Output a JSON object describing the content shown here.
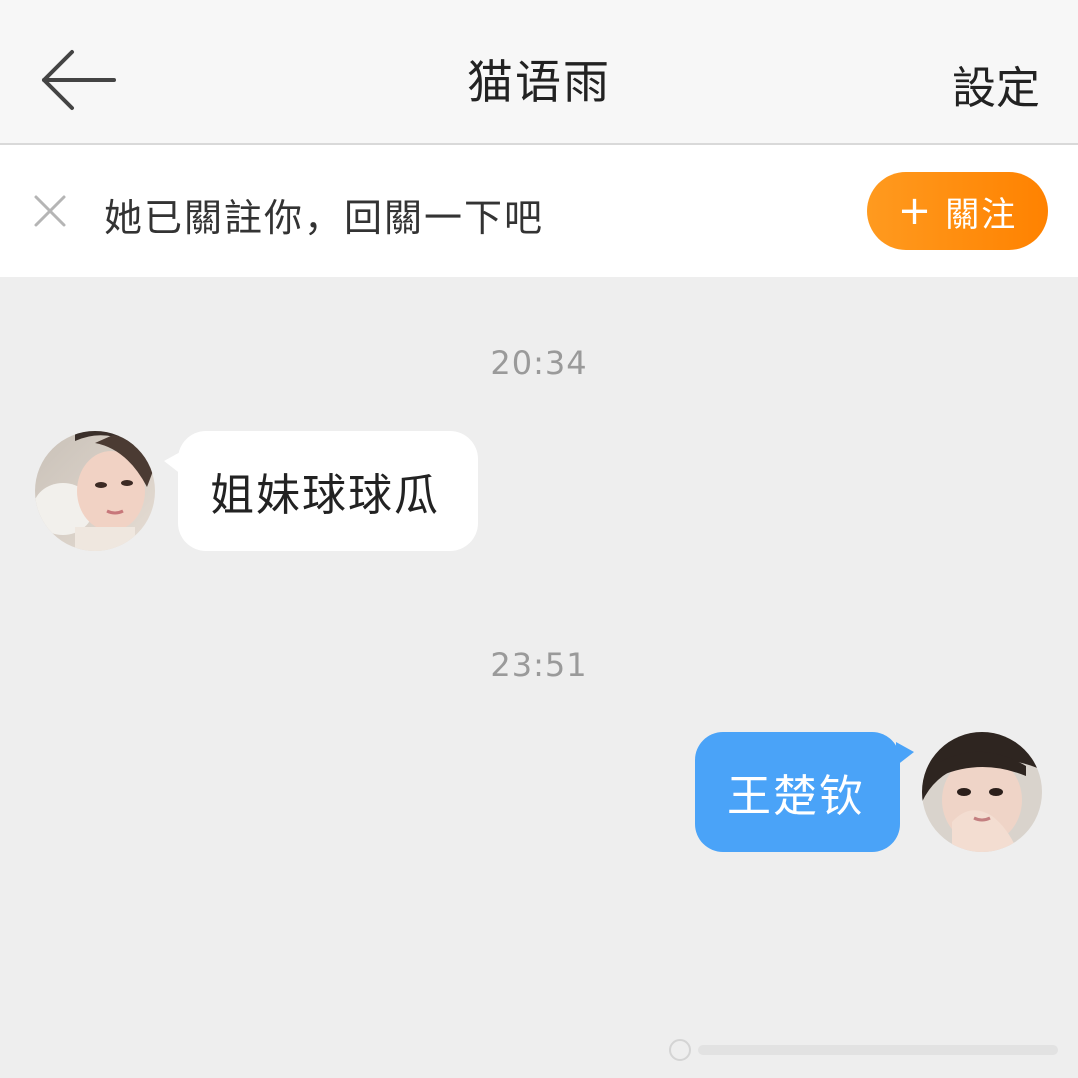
{
  "header": {
    "title": "猫语雨",
    "settings_label": "設定",
    "back_icon": "arrow-left-icon"
  },
  "banner": {
    "close_icon": "close-icon",
    "text": "她已關註你，回關一下吧",
    "follow_label": "關注",
    "follow_plus": "+",
    "accent": "#ff8c0a"
  },
  "chat": {
    "messages": [
      {
        "time": "20:34",
        "from": "other",
        "text": "姐妹球球瓜"
      },
      {
        "time": "23:51",
        "from": "self",
        "text": "王楚钦"
      }
    ],
    "incoming_bubble_color": "#ffffff",
    "outgoing_bubble_color": "#4aa3f8"
  }
}
